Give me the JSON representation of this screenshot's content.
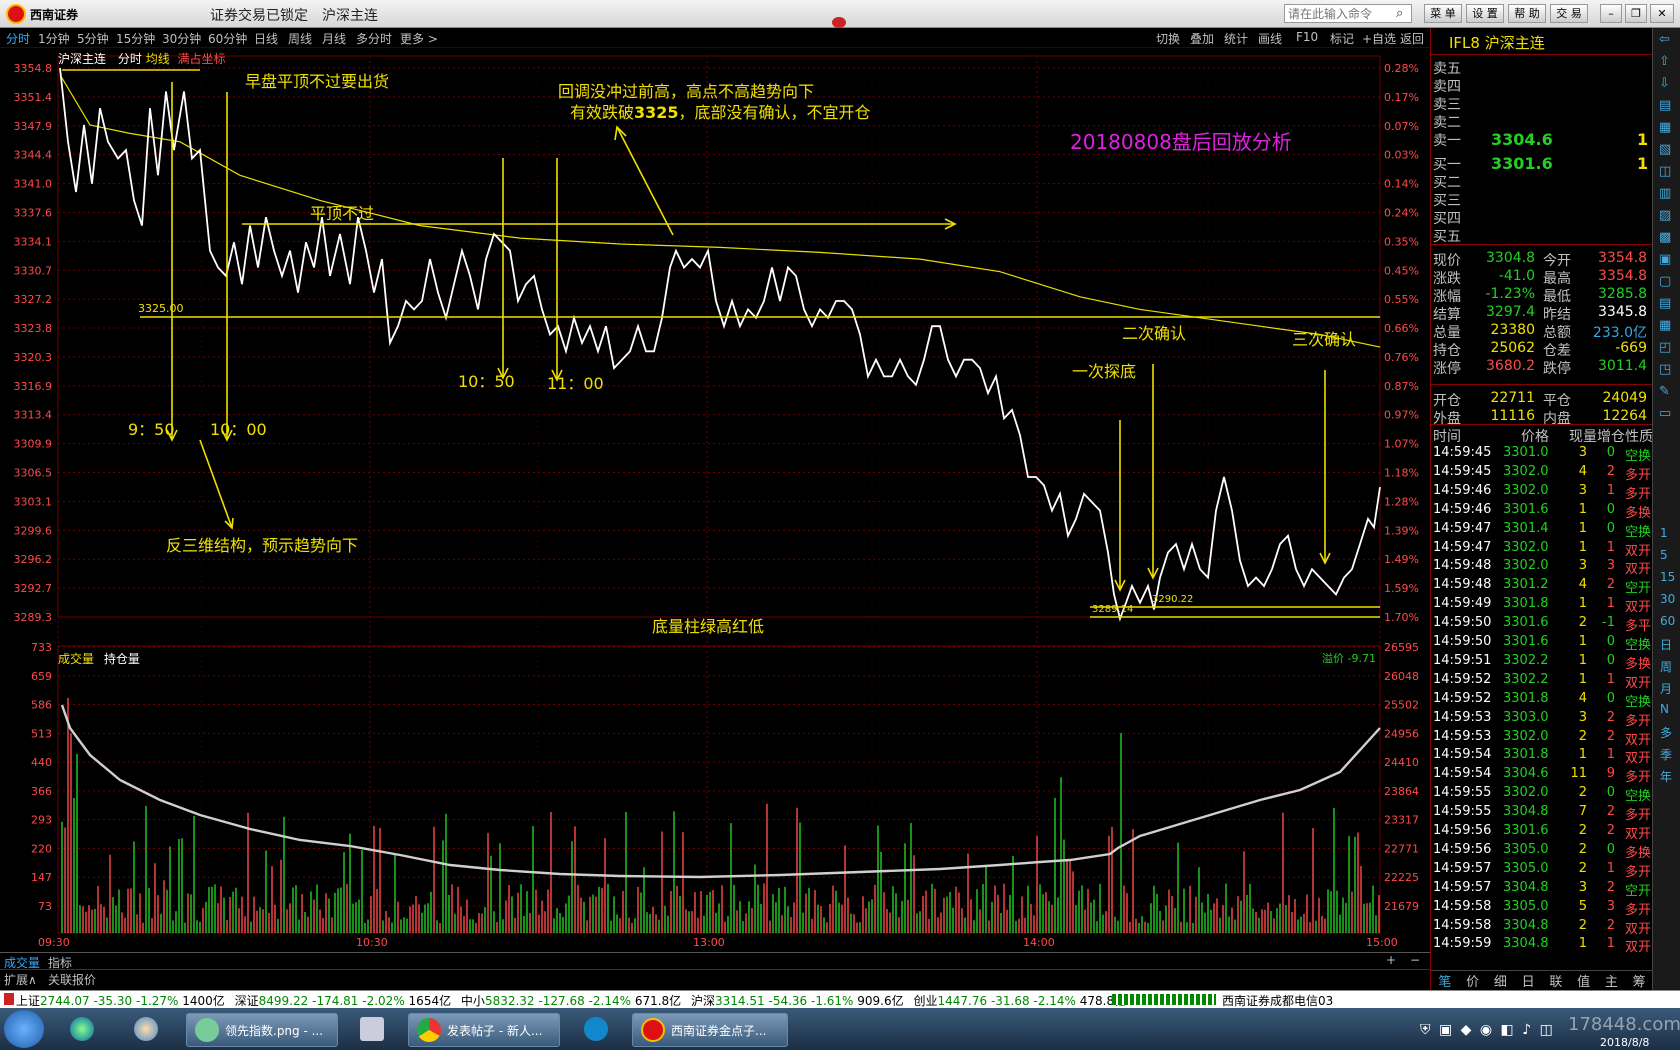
{
  "titlebar": {
    "app": "西南证券",
    "lock_status": "证券交易已锁定",
    "instrument": "沪深主连",
    "command_placeholder": "请在此输入命令",
    "buttons": [
      "菜 单",
      "设 置",
      "帮 助",
      "交 易"
    ]
  },
  "period_tabs": [
    "分时",
    "1分钟",
    "5分钟",
    "15分钟",
    "30分钟",
    "60分钟",
    "日线",
    "周线",
    "月线",
    "多分时",
    "更多 >"
  ],
  "toolbar_right": [
    "切换",
    "叠加",
    "统计",
    "画线",
    "F10",
    "标记",
    "+自选",
    "返回"
  ],
  "chart_header": {
    "name": "沪深主连",
    "mode": "分时",
    "avg": "均线",
    "coord": "满占坐标"
  },
  "price_axis": [
    "3354.8",
    "3351.4",
    "3347.9",
    "3344.4",
    "3341.0",
    "3337.6",
    "3334.1",
    "3330.7",
    "3327.2",
    "3323.8",
    "3320.3",
    "3316.9",
    "3313.4",
    "3309.9",
    "3306.5",
    "3303.1",
    "3299.6",
    "3296.2",
    "3292.7",
    "3289.3"
  ],
  "pct_axis": [
    "0.28%",
    "0.17%",
    "0.07%",
    "0.03%",
    "0.14%",
    "0.24%",
    "0.35%",
    "0.45%",
    "0.55%",
    "0.66%",
    "0.76%",
    "0.87%",
    "0.97%",
    "1.07%",
    "1.18%",
    "1.28%",
    "1.39%",
    "1.49%",
    "1.59%",
    "1.70%"
  ],
  "vol_axis": [
    "733",
    "659",
    "586",
    "513",
    "440",
    "366",
    "293",
    "220",
    "147",
    "73"
  ],
  "oi_axis": [
    "26595",
    "26048",
    "25502",
    "24956",
    "24410",
    "23864",
    "23317",
    "22771",
    "22225",
    "21679"
  ],
  "time_axis": [
    "09:30",
    "10:30",
    "13:00",
    "14:00",
    "15:00"
  ],
  "vol_header": {
    "vol": "成交量",
    "oi": "持仓量",
    "spread": "溢价 -9.71"
  },
  "annotations": {
    "a1": "早盘平顶不过要出货",
    "a2": "回调没冲过前高，高点不高趋势向下",
    "a3a": "有效跌破",
    "a3b": "3325",
    "a3c": "，底部没有确认，不宜开仓",
    "a4": "20180808盘后回放分析",
    "a5": "平顶不过",
    "a6": "3325.00",
    "a7": "10：50",
    "a8": "11：00",
    "a9": "9：50",
    "a10": "10：00",
    "a11": "反三维结构，预示趋势向下",
    "a12": "底量柱绿高红低",
    "a13": "一次探底",
    "a14": "二次确认",
    "a15": "三次确认",
    "a16": "3289.14",
    "a17": "3290.22"
  },
  "bottom_tabs": {
    "vol": "成交量",
    "ind": "指标",
    "expand": "扩展∧",
    "related": "关联报价"
  },
  "quote": {
    "title": "IFL8 沪深主连",
    "asks": [
      "卖五",
      "卖四",
      "卖三",
      "卖二",
      "卖一"
    ],
    "ask1_price": "3304.6",
    "ask1_vol": "1",
    "bids": [
      "买一",
      "买二",
      "买三",
      "买四",
      "买五"
    ],
    "bid1_price": "3301.6",
    "bid1_vol": "1",
    "stats": [
      {
        "l1": "现价",
        "v1": "3304.8",
        "l2": "今开",
        "v2": "3354.8",
        "c1": "green",
        "c2": "red"
      },
      {
        "l1": "涨跌",
        "v1": "-41.0",
        "l2": "最高",
        "v2": "3354.8",
        "c1": "green",
        "c2": "red"
      },
      {
        "l1": "涨幅",
        "v1": "-1.23%",
        "l2": "最低",
        "v2": "3285.8",
        "c1": "green",
        "c2": "green"
      },
      {
        "l1": "结算",
        "v1": "3297.4",
        "l2": "昨结",
        "v2": "3345.8",
        "c1": "green",
        "c2": "wht"
      },
      {
        "l1": "总量",
        "v1": "23380",
        "l2": "总额",
        "v2": "233.0亿",
        "c1": "yel",
        "c2": "cyan"
      },
      {
        "l1": "持仓",
        "v1": "25062",
        "l2": "仓差",
        "v2": "-669",
        "c1": "yel",
        "c2": "yel"
      },
      {
        "l1": "涨停",
        "v1": "3680.2",
        "l2": "跌停",
        "v2": "3011.4",
        "c1": "red",
        "c2": "green"
      }
    ],
    "stats2": [
      {
        "l1": "开仓",
        "v1": "22711",
        "l2": "平仓",
        "v2": "24049"
      },
      {
        "l1": "外盘",
        "v1": "11116",
        "l2": "内盘",
        "v2": "12264"
      }
    ],
    "tick_headers": [
      "时间",
      "价格",
      "现量",
      "增仓",
      "性质"
    ],
    "ticks": [
      [
        "14:59:45",
        "3301.0",
        "3",
        "0",
        "空换"
      ],
      [
        "14:59:45",
        "3302.0",
        "4",
        "2",
        "多开"
      ],
      [
        "14:59:46",
        "3302.0",
        "3",
        "1",
        "多开"
      ],
      [
        "14:59:46",
        "3301.6",
        "1",
        "0",
        "多换"
      ],
      [
        "14:59:47",
        "3301.4",
        "1",
        "0",
        "空换"
      ],
      [
        "14:59:47",
        "3302.0",
        "1",
        "1",
        "双开"
      ],
      [
        "14:59:48",
        "3302.0",
        "3",
        "3",
        "双开"
      ],
      [
        "14:59:48",
        "3301.2",
        "4",
        "2",
        "空开"
      ],
      [
        "14:59:49",
        "3301.8",
        "1",
        "1",
        "双开"
      ],
      [
        "14:59:50",
        "3301.6",
        "2",
        "-1",
        "多平"
      ],
      [
        "14:59:50",
        "3301.6",
        "1",
        "0",
        "空换"
      ],
      [
        "14:59:51",
        "3302.2",
        "1",
        "0",
        "多换"
      ],
      [
        "14:59:52",
        "3302.2",
        "1",
        "1",
        "双开"
      ],
      [
        "14:59:52",
        "3301.8",
        "4",
        "0",
        "空换"
      ],
      [
        "14:59:53",
        "3303.0",
        "3",
        "2",
        "多开"
      ],
      [
        "14:59:53",
        "3302.0",
        "2",
        "2",
        "双开"
      ],
      [
        "14:59:54",
        "3301.8",
        "1",
        "1",
        "双开"
      ],
      [
        "14:59:54",
        "3304.6",
        "11",
        "9",
        "多开"
      ],
      [
        "14:59:55",
        "3302.0",
        "2",
        "0",
        "空换"
      ],
      [
        "14:59:55",
        "3304.8",
        "7",
        "2",
        "多开"
      ],
      [
        "14:59:56",
        "3301.6",
        "2",
        "2",
        "双开"
      ],
      [
        "14:59:56",
        "3305.0",
        "2",
        "0",
        "多换"
      ],
      [
        "14:59:57",
        "3305.0",
        "2",
        "1",
        "多开"
      ],
      [
        "14:59:57",
        "3304.8",
        "3",
        "2",
        "空开"
      ],
      [
        "14:59:58",
        "3305.0",
        "5",
        "3",
        "多开"
      ],
      [
        "14:59:58",
        "3304.8",
        "2",
        "2",
        "双开"
      ],
      [
        "14:59:59",
        "3304.8",
        "1",
        "1",
        "双开"
      ]
    ],
    "bottom_tabs": [
      "笔",
      "价",
      "细",
      "日",
      "联",
      "值",
      "主",
      "筹"
    ]
  },
  "vtool_labels": [
    "1",
    "5",
    "15",
    "30",
    "60",
    "日",
    "周",
    "月",
    "N",
    "多",
    "季",
    "年"
  ],
  "statusbar": {
    "sh_label": "上证",
    "sh": "2744.07",
    "sh_chg": "-35.30",
    "sh_pct": "-1.27%",
    "sh_amt": "1400亿",
    "sz_label": "深证",
    "sz": "8499.22",
    "sz_chg": "-174.81",
    "sz_pct": "-2.02%",
    "sz_amt": "1654亿",
    "zx_label": "中小",
    "zx": "5832.32",
    "zx_chg": "-127.68",
    "zx_pct": "-2.14%",
    "zx_amt": "671.8亿",
    "hs_label": "沪深",
    "hs": "3314.51",
    "hs_chg": "-54.36",
    "hs_pct": "-1.61%",
    "hs_amt": "909.6亿",
    "cy_label": "创业",
    "cy": "1447.76",
    "cy_chg": "-31.68",
    "cy_pct": "-2.14%",
    "cy_amt": "478.8亿",
    "broker": "西南证券成都电信03"
  },
  "taskbar": {
    "tasks": [
      "领先指数.png - ...",
      "发表帖子 - 新人...",
      "西南证券金点子..."
    ],
    "watermark": "178448.com",
    "date": "2018/8/8"
  },
  "colors": {
    "up": "#ff4a4a",
    "down": "#22d022",
    "price_line": "#ffffff",
    "avg_line": "#e8e000",
    "annotation": "#f0e000",
    "title_magenta": "#e020e0",
    "grid": "#6a0000"
  }
}
